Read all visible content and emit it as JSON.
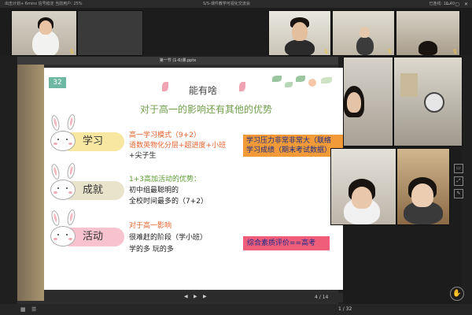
{
  "window": {
    "status_left": "出击计划+ 6mins  信号稳定  当前用户: 25%",
    "app_title": "S/S-课件教学可视化交流会",
    "status_right": "已连线: 16:40",
    "win_controls": "— ▢ ✕"
  },
  "ppt": {
    "file_title": "第一节 (1-6)课.pptx",
    "page_counter": "4 / 14",
    "page_counter_bottom": "1 / 32"
  },
  "slide": {
    "number": "32",
    "title_main": "能有啥",
    "subtitle": "对于高一的影响还有其他的优势",
    "sections": [
      {
        "label": "学习",
        "pill_color": "#f7e7a0",
        "notes": [
          "高一学习模式（9+2）",
          "语数英物化分层+超进度+小班",
          "+尖子生"
        ],
        "note_colors": [
          "#e9632e",
          "#e9632e",
          "#222222"
        ]
      },
      {
        "label": "成就",
        "pill_color": "#e8e3cb",
        "notes": [
          "1+3高加活动的优势：",
          "初中组最聪明的",
          "全校时间最多的（7+2）"
        ],
        "note_colors": [
          "#5a9a32",
          "#222222",
          "#222222"
        ]
      },
      {
        "label": "活动",
        "pill_color": "#f8c3cf",
        "notes": [
          "对于高一影响",
          "很难赶的阶段（学小班）",
          "学的多 玩的多"
        ],
        "note_colors": [
          "#e9632e",
          "#222222",
          "#222222"
        ]
      }
    ],
    "box_orange_lines": [
      "学习压力非常非常大（联络",
      "学习成绩（期末考试数据）"
    ],
    "box_pink_text": "综合素质评价==高考"
  },
  "tiles": {
    "top": [
      {
        "name": "",
        "has_mic": true
      },
      {
        "name": "",
        "has_mic": true
      },
      {
        "name": "",
        "has_mic": true
      },
      {
        "name": "",
        "has_mic": true
      },
      {
        "name": "",
        "has_mic": true
      }
    ]
  },
  "colors": {
    "accent_teal": "#6fb8a3",
    "mic_yellow": "#f3c33d"
  }
}
